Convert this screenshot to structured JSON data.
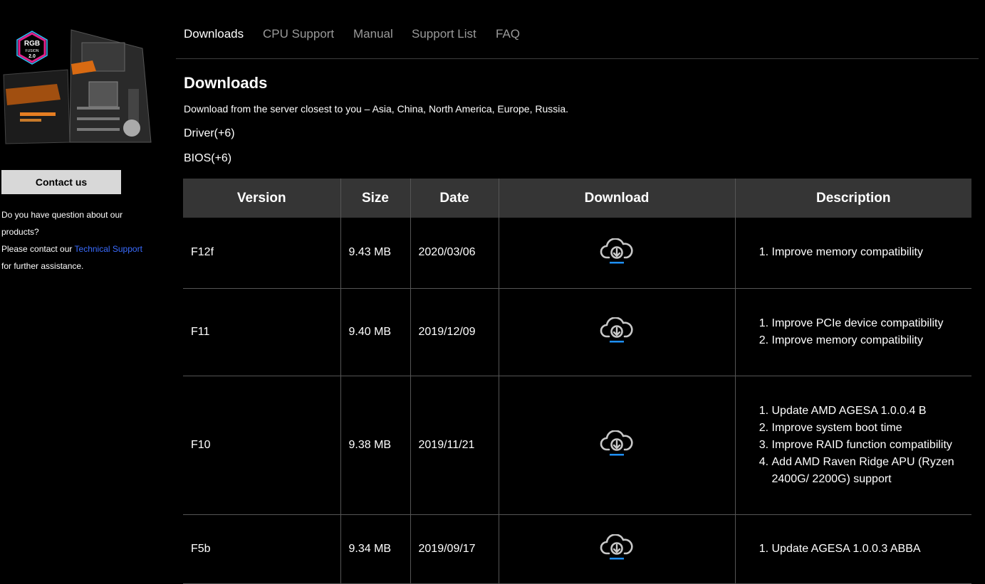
{
  "sidebar": {
    "contact_button": "Contact us",
    "question_text": "Do you have question about our products?",
    "contact_prefix": "Please contact our ",
    "technical_support_link": "Technical Support",
    "contact_suffix": " for further assistance."
  },
  "nav": {
    "items": [
      {
        "label": "Downloads",
        "active": true
      },
      {
        "label": "CPU Support",
        "active": false
      },
      {
        "label": "Manual",
        "active": false
      },
      {
        "label": "Support List",
        "active": false
      },
      {
        "label": "FAQ",
        "active": false
      }
    ]
  },
  "main": {
    "heading": "Downloads",
    "intro": "Download from the server closest to you – Asia, China, North America, Europe, Russia.",
    "categories": [
      "Driver(+6)",
      "BIOS(+6)"
    ]
  },
  "table": {
    "headers": [
      "Version",
      "Size",
      "Date",
      "Download",
      "Description"
    ],
    "rows": [
      {
        "version": "F12f",
        "size": "9.43 MB",
        "date": "2020/03/06",
        "description": [
          "Improve memory compatibility"
        ]
      },
      {
        "version": "F11",
        "size": "9.40 MB",
        "date": "2019/12/09",
        "description": [
          "Improve PCIe device compatibility",
          "Improve memory compatibility"
        ]
      },
      {
        "version": "F10",
        "size": "9.38 MB",
        "date": "2019/11/21",
        "description": [
          "Update AMD AGESA 1.0.0.4 B",
          "Improve system boot time",
          "Improve RAID function compatibility",
          "Add AMD Raven Ridge APU (Ryzen 2400G/ 2200G) support"
        ]
      },
      {
        "version": "F5b",
        "size": "9.34 MB",
        "date": "2019/09/17",
        "description": [
          "Update AGESA 1.0.0.3 ABBA"
        ]
      }
    ],
    "download_icon": "cloud-download-icon"
  },
  "colors": {
    "background": "#000000",
    "header_bg": "#353535",
    "link_blue": "#3a6cff",
    "icon_gray": "#c8c8c8",
    "icon_accent": "#1e90ff",
    "nav_inactive": "#9a9a9a"
  }
}
